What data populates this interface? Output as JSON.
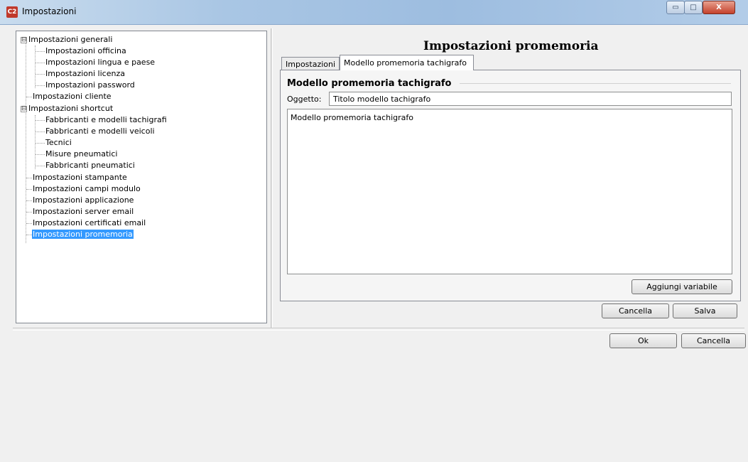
{
  "window": {
    "title": "Impostazioni",
    "app_icon": "C2",
    "controls": {
      "minimize": "▭",
      "maximize": "□",
      "close": "X"
    }
  },
  "tree": {
    "items": [
      {
        "label": "Impostazioni generali",
        "level": 0,
        "expander": "⊟"
      },
      {
        "label": "Impostazioni officina",
        "level": 1
      },
      {
        "label": "Impostazioni lingua e paese",
        "level": 1
      },
      {
        "label": "Impostazioni licenza",
        "level": 1
      },
      {
        "label": "Impostazioni password",
        "level": 1
      },
      {
        "label": "Impostazioni cliente",
        "level": 0
      },
      {
        "label": "Impostazioni shortcut",
        "level": 0,
        "expander": "⊟"
      },
      {
        "label": "Fabbricanti e modelli tachigrafi",
        "level": 1
      },
      {
        "label": "Fabbricanti e modelli veicoli",
        "level": 1
      },
      {
        "label": "Tecnici",
        "level": 1
      },
      {
        "label": "Misure pneumatici",
        "level": 1
      },
      {
        "label": "Fabbricanti pneumatici",
        "level": 1
      },
      {
        "label": "Impostazioni stampante",
        "level": 0
      },
      {
        "label": "Impostazioni campi modulo",
        "level": 0
      },
      {
        "label": "Impostazioni applicazione",
        "level": 0
      },
      {
        "label": "Impostazioni server email",
        "level": 0
      },
      {
        "label": "Impostazioni certificati email",
        "level": 0
      },
      {
        "label": "Impostazioni promemoria",
        "level": 0,
        "selected": true
      }
    ]
  },
  "panel": {
    "title": "Impostazioni promemoria",
    "tabs": [
      {
        "label": "Impostazioni",
        "active": false
      },
      {
        "label": "Modello promemoria tachigrafo",
        "active": true
      }
    ],
    "group_title": "Modello promemoria tachigrafo",
    "oggetto_label": "Oggetto:",
    "oggetto_value": "Titolo modello tachigrafo",
    "body_text": "Modello promemoria tachigrafo",
    "add_variable_label": "Aggiungi variabile",
    "cancel_label": "Cancella",
    "save_label": "Salva"
  },
  "footer": {
    "ok_label": "Ok",
    "cancel_label": "Cancella"
  },
  "colors": {
    "selection": "#3399ff",
    "titlebar": "#a9c6e4"
  }
}
